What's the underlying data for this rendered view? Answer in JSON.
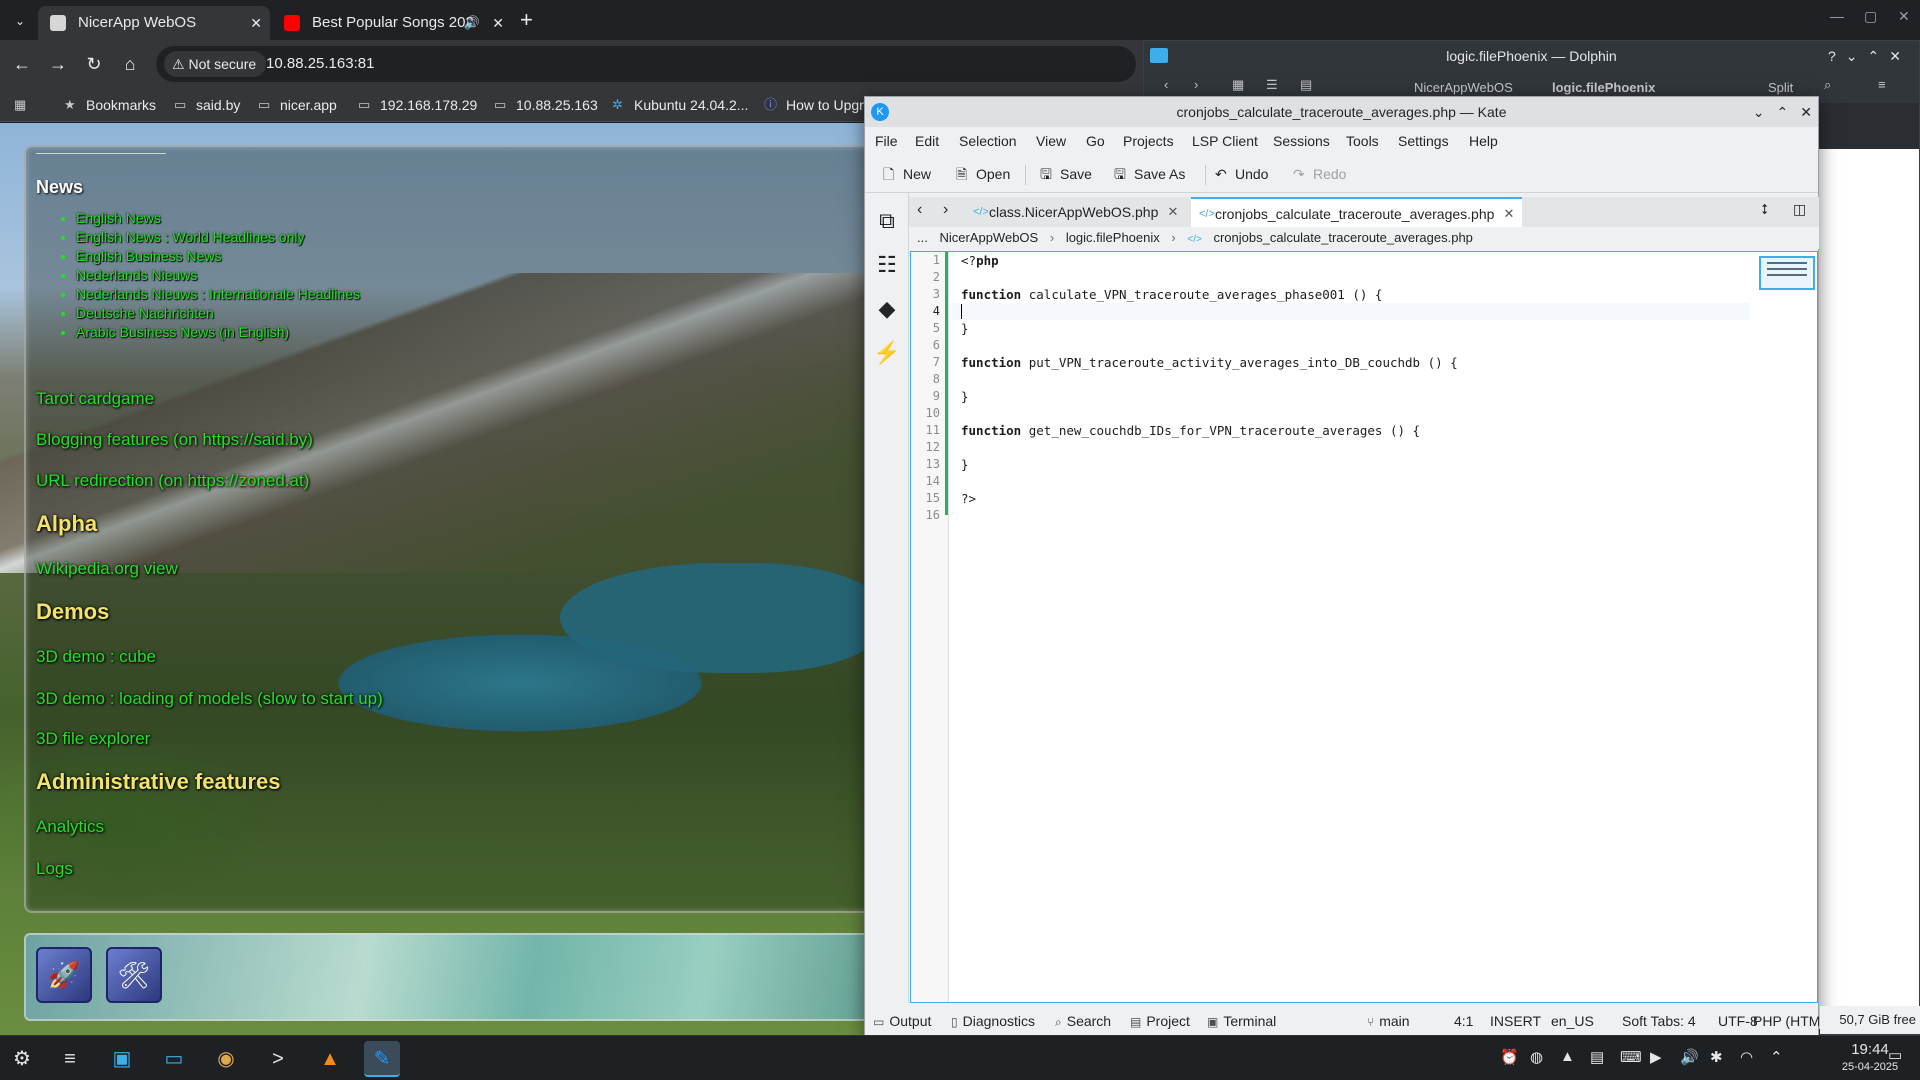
{
  "browser": {
    "tabs": [
      {
        "title": "NicerApp WebOS"
      },
      {
        "title": "Best Popular Songs 202"
      }
    ],
    "not_secure": "Not secure",
    "url": "10.88.25.163:81",
    "bookmarks": [
      "Bookmarks",
      "said.by",
      "nicer.app",
      "192.168.178.29",
      "10.88.25.163",
      "Kubuntu 24.04.2...",
      "How to Upgr"
    ]
  },
  "webpage": {
    "news_heading": "News",
    "news_items": [
      "English News",
      "English News : World Headlines only",
      "English Business News",
      "Nederlands Nieuws",
      "Nederlands Nieuws : Internationale Headlines",
      "Deutsche Nachrichten",
      "Arabic Business News (in English)"
    ],
    "menu": {
      "tarot": "Tarot cardgame",
      "blogging": "Blogging features (on https://said.by)",
      "url_redirect": "URL redirection (on https://zoned.at)",
      "alpha": "Alpha",
      "wikipedia": "Wikipedia.org view",
      "demos": "Demos",
      "demo_cube": "3D demo : cube",
      "demo_models": "3D demo : loading of models (slow to start up)",
      "file_explorer": "3D file explorer",
      "admin": "Administrative features",
      "analytics": "Analytics",
      "logs": "Logs"
    }
  },
  "dolphin": {
    "title": "logic.filePhoenix — Dolphin",
    "crumb1": "NicerAppWebOS",
    "crumb2": "logic.filePhoenix",
    "split": "Split"
  },
  "kate": {
    "title": "cronjobs_calculate_traceroute_averages.php — Kate",
    "menu": [
      "File",
      "Edit",
      "Selection",
      "View",
      "Go",
      "Projects",
      "LSP Client",
      "Sessions",
      "Tools",
      "Settings",
      "Help"
    ],
    "toolbar": {
      "new": "New",
      "open": "Open",
      "save": "Save",
      "save_as": "Save As",
      "undo": "Undo",
      "redo": "Redo"
    },
    "tabs": [
      "class.NicerAppWebOS.php",
      "cronjobs_calculate_traceroute_averages.php"
    ],
    "breadcrumb": [
      "...",
      "NicerAppWebOS",
      "logic.filePhoenix",
      "cronjobs_calculate_traceroute_averages.php"
    ],
    "code": [
      "<?php",
      "",
      "function calculate_VPN_traceroute_averages_phase001 () {",
      "",
      "}",
      "",
      "function put_VPN_traceroute_activity_averages_into_DB_couchdb () {",
      "",
      "}",
      "",
      "function get_new_couchdb_IDs_for_VPN_traceroute_averages () {",
      "",
      "}",
      "",
      "?>",
      ""
    ],
    "status": {
      "output": "Output",
      "diagnostics": "Diagnostics",
      "search": "Search",
      "project": "Project",
      "terminal": "Terminal",
      "branch": "main",
      "position": "4:1",
      "mode": "INSERT",
      "lang": "en_US",
      "tabs": "Soft Tabs: 4",
      "encoding": "UTF-8",
      "syntax": "PHP (HTML)"
    }
  },
  "free_space": "50,7 GiB free",
  "clock": {
    "time": "19:44",
    "date": "25-04-2025"
  }
}
